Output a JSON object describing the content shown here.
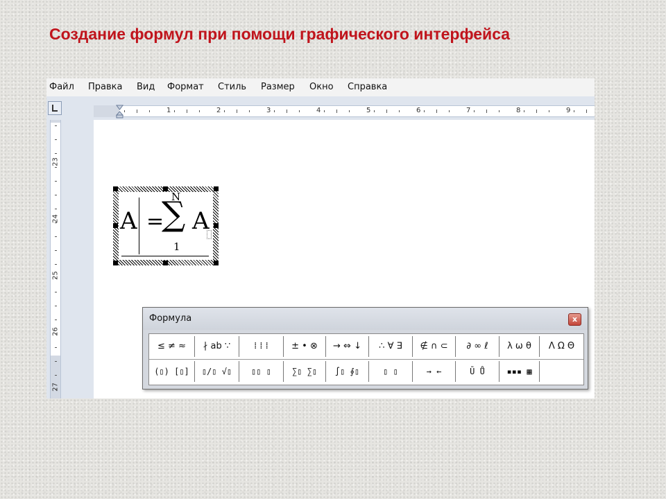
{
  "slide": {
    "title": "Создание формул при помощи графического интерфейса"
  },
  "menubar": {
    "items": [
      "Файл",
      "Правка",
      "Вид",
      "Формат",
      "Стиль",
      "Размер",
      "Окно",
      "Справка"
    ]
  },
  "ruler": {
    "horizontal_labels": [
      "1",
      "2",
      "3",
      "4",
      "5",
      "6",
      "7",
      "8",
      "9"
    ],
    "vertical_labels": [
      "23",
      "24",
      "25",
      "26",
      "27"
    ]
  },
  "equation": {
    "lhs": "A",
    "equals": "=",
    "operator": "∑",
    "upper_limit": "N",
    "lower_limit": "1",
    "term": "A"
  },
  "formula_toolbar": {
    "title": "Формула",
    "close_label": "x",
    "row1": [
      "≤ ≠ ≈",
      "∤ ab ∵",
      "⁞ ⁞ ⁞",
      "± • ⊗",
      "→ ⇔ ↓",
      "∴ ∀ ∃",
      "∉ ∩ ⊂",
      "∂ ∞ ℓ",
      "λ ω θ",
      "Λ Ω Θ"
    ],
    "row2": [
      "(▯) [▯]",
      "▯/▯ √▯",
      "▯▯ ▯",
      "∑▯ ∑▯",
      "∫▯ ∮▯",
      "▯ ▯",
      "→ ←",
      "Ū Ů",
      "▪▪▪ ▦"
    ]
  },
  "colors": {
    "title": "#c0141c",
    "page": "#ffffff",
    "window_bg": "#dfe5ee"
  }
}
